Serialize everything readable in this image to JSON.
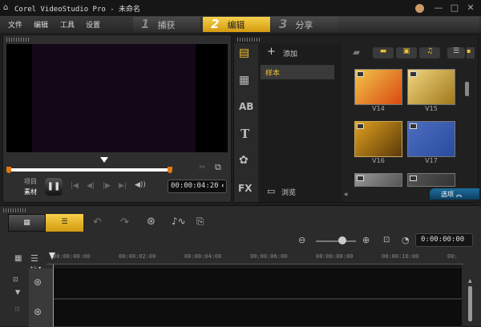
{
  "window": {
    "title": "Corel VideoStudio Pro - 未命名",
    "minimize": "—",
    "maximize": "□",
    "close": "✕"
  },
  "menu": [
    "文件",
    "编辑",
    "工具",
    "设置"
  ],
  "steps": [
    {
      "num": "1",
      "label": "捕获"
    },
    {
      "num": "2",
      "label": "编辑"
    },
    {
      "num": "3",
      "label": "分享"
    }
  ],
  "player": {
    "mode_project": "项目",
    "mode_clip": "素材",
    "timecode": "00:00:04:20"
  },
  "library": {
    "add_label": "添加",
    "folders": [
      "样本"
    ],
    "browse_label": "浏览",
    "options_label": "选项",
    "thumbnails": [
      {
        "label": "V14",
        "colors": [
          "#f3c44a",
          "#d84a10"
        ]
      },
      {
        "label": "V15",
        "colors": [
          "#f1d680",
          "#a0781a"
        ]
      },
      {
        "label": "V16",
        "colors": [
          "#e0a020",
          "#5a3a08"
        ]
      },
      {
        "label": "V17",
        "colors": [
          "#4d6ec0",
          "#2a4c9e"
        ]
      },
      {
        "label": "",
        "colors": [
          "#999",
          "#555"
        ]
      },
      {
        "label": "",
        "colors": [
          "#555",
          "#333"
        ]
      }
    ]
  },
  "timeline": {
    "timecode": "0:00:00:00",
    "zoom_level": 0.65,
    "track_add_label": "+/- ▾",
    "ruler": [
      "00:00:00:00",
      "00:00:02:00",
      "00:00:04:00",
      "00:00:06:00",
      "00:00:08:00",
      "00:00:10:00",
      "00:"
    ]
  },
  "colors": {
    "accent": "#f0c030",
    "slider_handle": "#e07a10"
  }
}
